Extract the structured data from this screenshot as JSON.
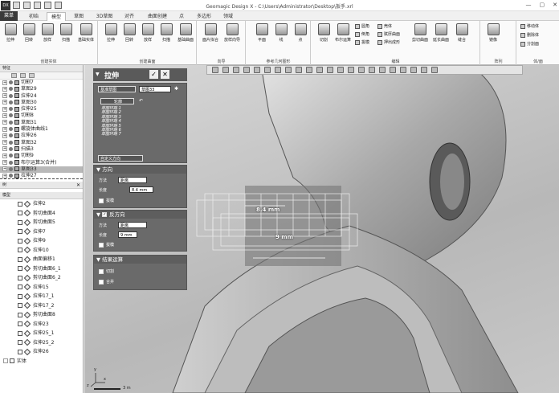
{
  "app": {
    "title": "Geomagic Design X - C:\\Users\\Administrator\\Desktop\\扳手.xrl",
    "logo": "DX",
    "window_controls": [
      "—",
      "▢",
      "✕"
    ]
  },
  "menu_tabs": [
    "菜单",
    "初始",
    "模型",
    "草图",
    "3D草图",
    "对齐",
    "曲面创建",
    "点",
    "多边形",
    "领域"
  ],
  "active_tab": "模型",
  "ribbon": {
    "groups": [
      {
        "label": "创建实体",
        "buttons": [
          "拉伸",
          "回转",
          "放样",
          "扫描",
          "基础实体"
        ]
      },
      {
        "label": "创建曲面",
        "buttons": [
          "拉伸",
          "回转",
          "放样",
          "扫描",
          "基础曲面"
        ]
      },
      {
        "label": "向导",
        "buttons": [
          "面片拟合",
          "放样向导"
        ]
      },
      {
        "label": "参考几何图形",
        "buttons": [
          "平面",
          "线",
          "点"
        ]
      },
      {
        "label": "编辑",
        "buttons": [
          "切割",
          "布尔运算"
        ],
        "small": [
          "圆角",
          "倒角",
          "拔模",
          "壳体",
          "赋厚曲面",
          "押出成形"
        ],
        "extra": [
          "剪切曲面",
          "延长曲面",
          "缝合"
        ]
      },
      {
        "label": "阵列",
        "buttons": [
          "镜像"
        ]
      },
      {
        "label": "体/面",
        "small": [
          "移动体",
          "删除体",
          "分割面"
        ]
      }
    ]
  },
  "feature_panel": {
    "title": "特征",
    "items": [
      {
        "label": "切割7",
        "icon": "cut-icon"
      },
      {
        "label": "草图29",
        "icon": "sketch-icon"
      },
      {
        "label": "拉伸24",
        "icon": "extrude-icon"
      },
      {
        "label": "草图30",
        "icon": "sketch-icon"
      },
      {
        "label": "拉伸25",
        "icon": "extrude-icon"
      },
      {
        "label": "切割8",
        "icon": "cut-icon"
      },
      {
        "label": "草图31",
        "icon": "sketch-icon"
      },
      {
        "label": "螺旋体曲线1",
        "icon": "helix-icon"
      },
      {
        "label": "拉伸26",
        "icon": "extrude-icon"
      },
      {
        "label": "草图32",
        "icon": "sketch-icon"
      },
      {
        "label": "扫描3",
        "icon": "sweep-icon"
      },
      {
        "label": "切割9",
        "icon": "cut-icon"
      },
      {
        "label": "布尔运算3(合并)",
        "icon": "boolean-icon"
      },
      {
        "label": "草图33",
        "icon": "sketch-icon"
      },
      {
        "label": "拉伸27",
        "icon": "extrude-icon"
      }
    ]
  },
  "tree_panel": {
    "title": "树"
  },
  "model_panel": {
    "title": "模型",
    "items": [
      "拉伸2",
      "剪切曲面4",
      "剪切曲面5",
      "拉伸7",
      "拉伸9",
      "拉伸10",
      "曲面偏移1",
      "剪切曲面6_1",
      "剪切曲面6_2",
      "拉伸15",
      "拉伸17_1",
      "拉伸17_2",
      "剪切曲面8",
      "拉伸23",
      "拉伸25_1",
      "拉伸25_2",
      "拉伸26"
    ],
    "footer": "实体"
  },
  "dialog": {
    "title": "拉伸",
    "ok": "✓",
    "cancel": "✕",
    "base_sketch_label": "基准草图",
    "base_sketch_value": "草图33",
    "contour_label": "轮廓",
    "contours": [
      "草图环路 1",
      "草图环路 2",
      "草图环路 3",
      "草图环路 4",
      "草图环路 5",
      "草图环路 6",
      "草图环路 7"
    ],
    "custom_direction": "自定义方向",
    "direction": {
      "title": "方向",
      "method_label": "方法",
      "method_value": "距离",
      "length_label": "长度",
      "length_value": "8.4 mm",
      "draft_label": "拔模"
    },
    "reverse": {
      "title": "反方向",
      "checked": true,
      "method_label": "方法",
      "method_value": "距离",
      "length_label": "长度",
      "length_value": "9 mm",
      "draft_label": "拔模"
    },
    "result": {
      "title": "结果运算",
      "options": [
        "切割",
        "合并"
      ]
    }
  },
  "viewport": {
    "dim1": "8.4 mm",
    "dim2": "9 mm",
    "axis_x": "x",
    "axis_y": "y",
    "axis_z": "z",
    "scale": "3 m"
  }
}
